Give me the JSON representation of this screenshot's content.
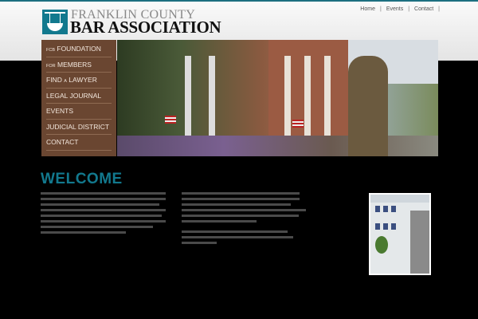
{
  "header": {
    "logo_line1": "FRANKLIN COUNTY",
    "logo_line2": "BAR ASSOCIATION",
    "top_nav": [
      "Home",
      "Events",
      "Contact"
    ],
    "separator": "|"
  },
  "menu": {
    "items": [
      {
        "prefix": "FCB",
        "label": "FOUNDATION"
      },
      {
        "prefix": "FOR",
        "label": "MEMBERS"
      },
      {
        "label": "FIND",
        "mid": "A",
        "label2": "LAWYER"
      },
      {
        "label": "LEGAL JOURNAL"
      },
      {
        "label": "EVENTS"
      },
      {
        "label": "JUDICIAL DISTRICT"
      },
      {
        "label": "CONTACT"
      }
    ]
  },
  "main": {
    "heading": "WELCOME"
  },
  "colors": {
    "accent": "#12798e",
    "menu_bg": "#6a4631"
  }
}
